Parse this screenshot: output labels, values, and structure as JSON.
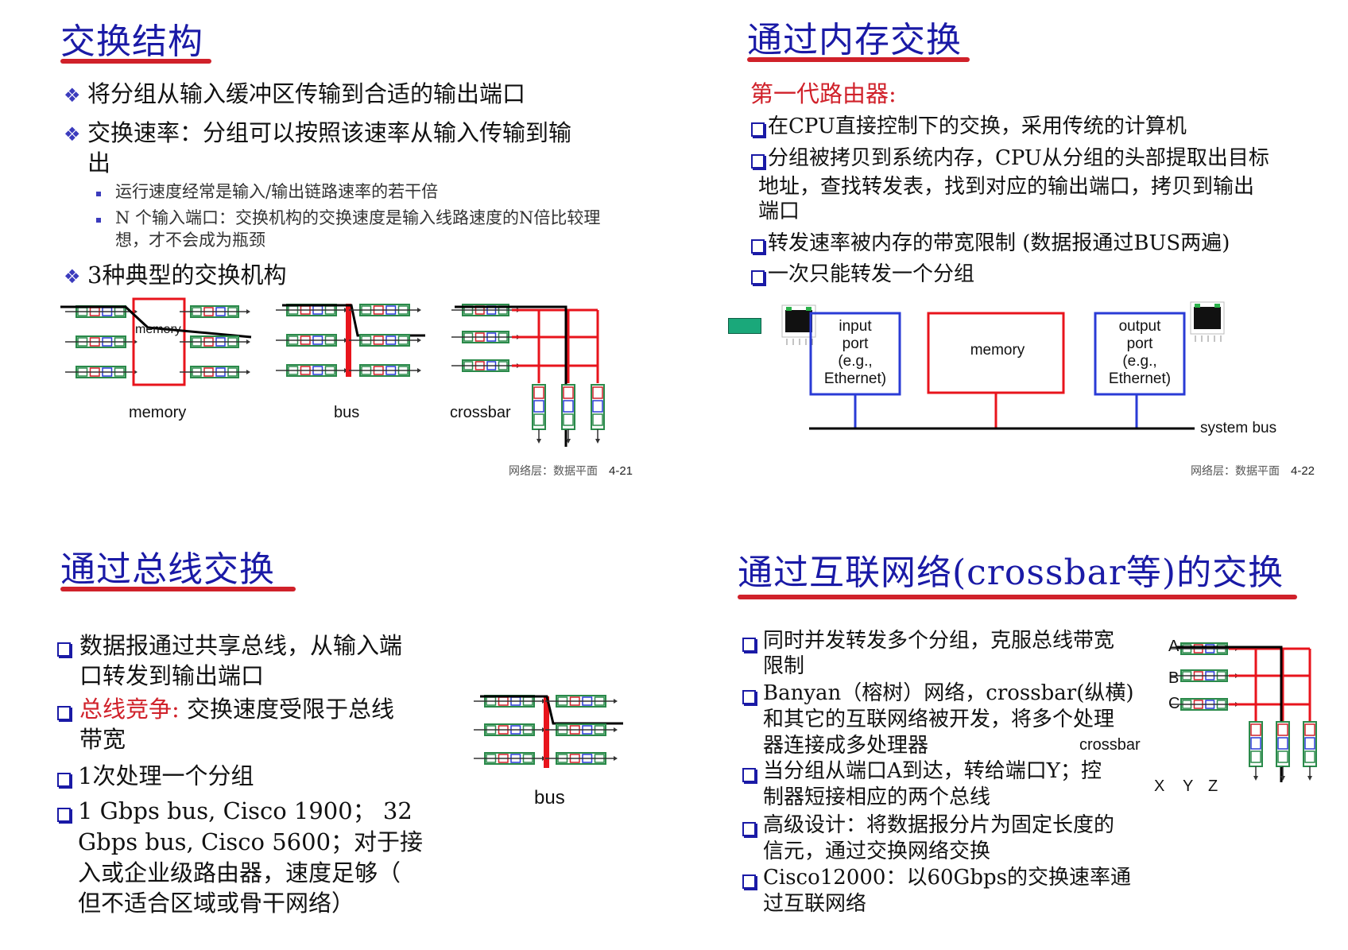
{
  "slide21": {
    "title": "交换结构",
    "bullets": [
      "将分组从输入缓冲区传输到合适的输出端口",
      "交换速率：分组可以按照该速率从输入传输到输",
      "出"
    ],
    "sub": [
      "运行速度经常是输入/输出链路速率的若干倍",
      "N 个输入端口：交换机构的交换速度是输入线路速度的N倍比较理",
      "想，才不会成为瓶颈"
    ],
    "bullet3": "3种典型的交换机构",
    "labels": {
      "memory_inner": "memory",
      "memory": "memory",
      "bus": "bus",
      "crossbar": "crossbar"
    },
    "footer": "网络层：数据平面",
    "page": "4-21"
  },
  "slide22": {
    "title": "通过内存交换",
    "subtitle": "第一代路由器:",
    "bullets": [
      "在CPU直接控制下的交换，采用传统的计算机",
      "分组被拷贝到系统内存，CPU从分组的头部提取出目标",
      "地址，查找转发表，找到对应的输出端口，拷贝到输出",
      "端口",
      "转发速率被内存的带宽限制 (数据报通过BUS两遍)",
      "一次只能转发一个分组"
    ],
    "diagram": {
      "input_port": [
        "input",
        "port",
        "(e.g.,",
        "Ethernet)"
      ],
      "memory": "memory",
      "output_port": [
        "output",
        "port",
        "(e.g.,",
        "Ethernet)"
      ],
      "system_bus": "system bus"
    },
    "footer": "网络层：数据平面",
    "page": "4-22"
  },
  "slide23": {
    "title": "通过总线交换",
    "bullets": [
      "数据报通过共享总线，从输入端",
      "口转发到输出端口",
      "总线竞争:",
      " 交换速度受限于总线",
      "带宽",
      "1次处理一个分组",
      "1 Gbps bus, Cisco 1900；  32",
      "Gbps bus, Cisco 5600；对于接",
      "入或企业级路由器，速度足够（",
      "但不适合区域或骨干网络）"
    ],
    "bus_label": "bus"
  },
  "slide24": {
    "title": "通过互联网络(crossbar等)的交换",
    "bullets": [
      "同时并发转发多个分组，克服总线带宽",
      "限制",
      "Banyan（榕树）网络，crossbar(纵横)",
      "和其它的互联网络被开发，将多个处理",
      "器连接成多处理器",
      "当分组从端口A到达，转给端口Y；控",
      "制器短接相应的两个总线",
      "高级设计：将数据报分片为固定长度的",
      "信元，通过交换网络交换",
      "Cisco12000：以60Gbps的交换速率通",
      "过互联网络"
    ],
    "ports_in": [
      "A",
      "B",
      "C"
    ],
    "ports_out": [
      "X",
      "Y",
      "Z"
    ],
    "crossbar_label": "crossbar"
  },
  "colors": {
    "title": "#1a1aa6",
    "underline": "#d0212a",
    "fabric_red": "#e8141c",
    "port_blue": "#2a3bd6",
    "accent_green": "#1aa87a"
  }
}
